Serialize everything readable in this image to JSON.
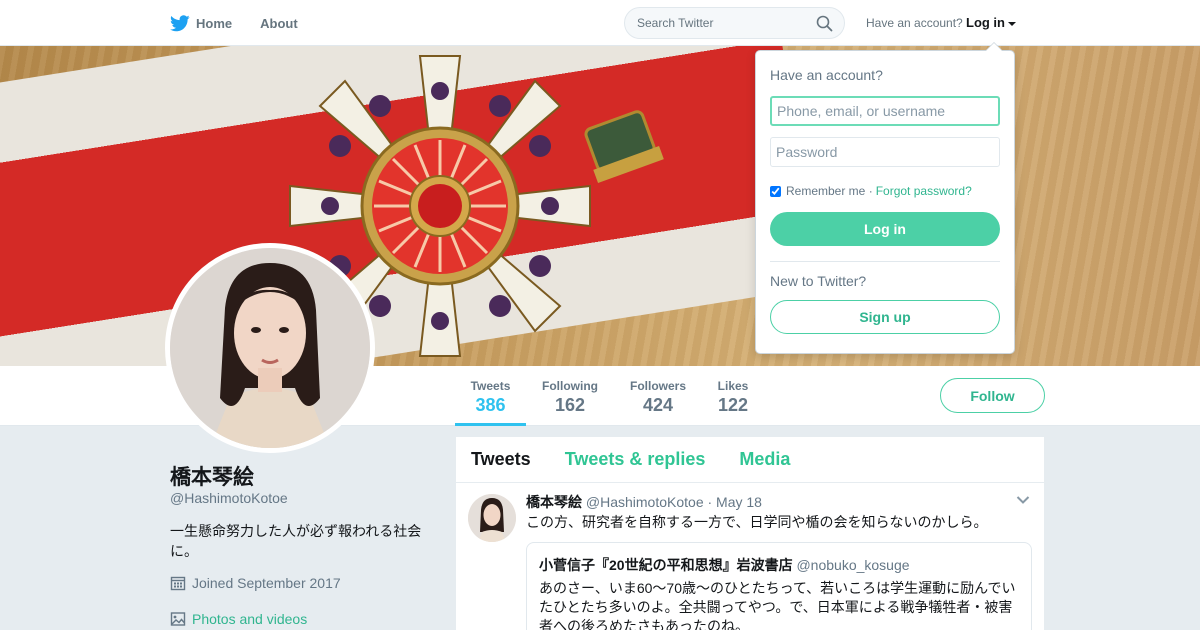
{
  "nav": {
    "home_label": "Home",
    "about_label": "About",
    "search_placeholder": "Search Twitter",
    "have_account_text": "Have an account?",
    "login_label": "Log in"
  },
  "profile": {
    "name": "橋本琴絵",
    "handle": "@HashimotoKotoe",
    "bio": "一生懸命努力した人が必ず報われる社会に。",
    "joined": "Joined September 2017",
    "photos_link": "Photos and videos"
  },
  "stats": [
    {
      "label": "Tweets",
      "value": "386"
    },
    {
      "label": "Following",
      "value": "162"
    },
    {
      "label": "Followers",
      "value": "424"
    },
    {
      "label": "Likes",
      "value": "122"
    }
  ],
  "follow_label": "Follow",
  "timeline": {
    "tabs": [
      "Tweets",
      "Tweets & replies",
      "Media"
    ],
    "tweet": {
      "name": "橋本琴絵",
      "handle": "@HashimotoKotoe",
      "date": "· May 18",
      "text": "この方、研究者を自称する一方で、日学同や楯の会を知らないのかしら。",
      "quote": {
        "name": "小菅信子『20世紀の平和思想』岩波書店",
        "handle": "@nobuko_kosuge",
        "text": "あのさー、いま60～70歳～のひとたちって、若いころは学生運動に励んでいたひとたち多いのよ。全共闘ってやつ。で、日本軍による戦争犠牲者・被害者への後ろめたさもあったのね。"
      }
    }
  },
  "login_dropdown": {
    "title": "Have an account?",
    "username_placeholder": "Phone, email, or username",
    "password_placeholder": "Password",
    "remember_label": "Remember me",
    "separator": "·",
    "forgot_label": "Forgot password?",
    "login_button": "Log in",
    "new_text": "New to Twitter?",
    "signup_button": "Sign up"
  },
  "colors": {
    "accent": "#4cd0a6",
    "accent_text": "#30b58f",
    "active_stat": "#2fc2ef",
    "twitter_blue": "#1da1f2"
  }
}
